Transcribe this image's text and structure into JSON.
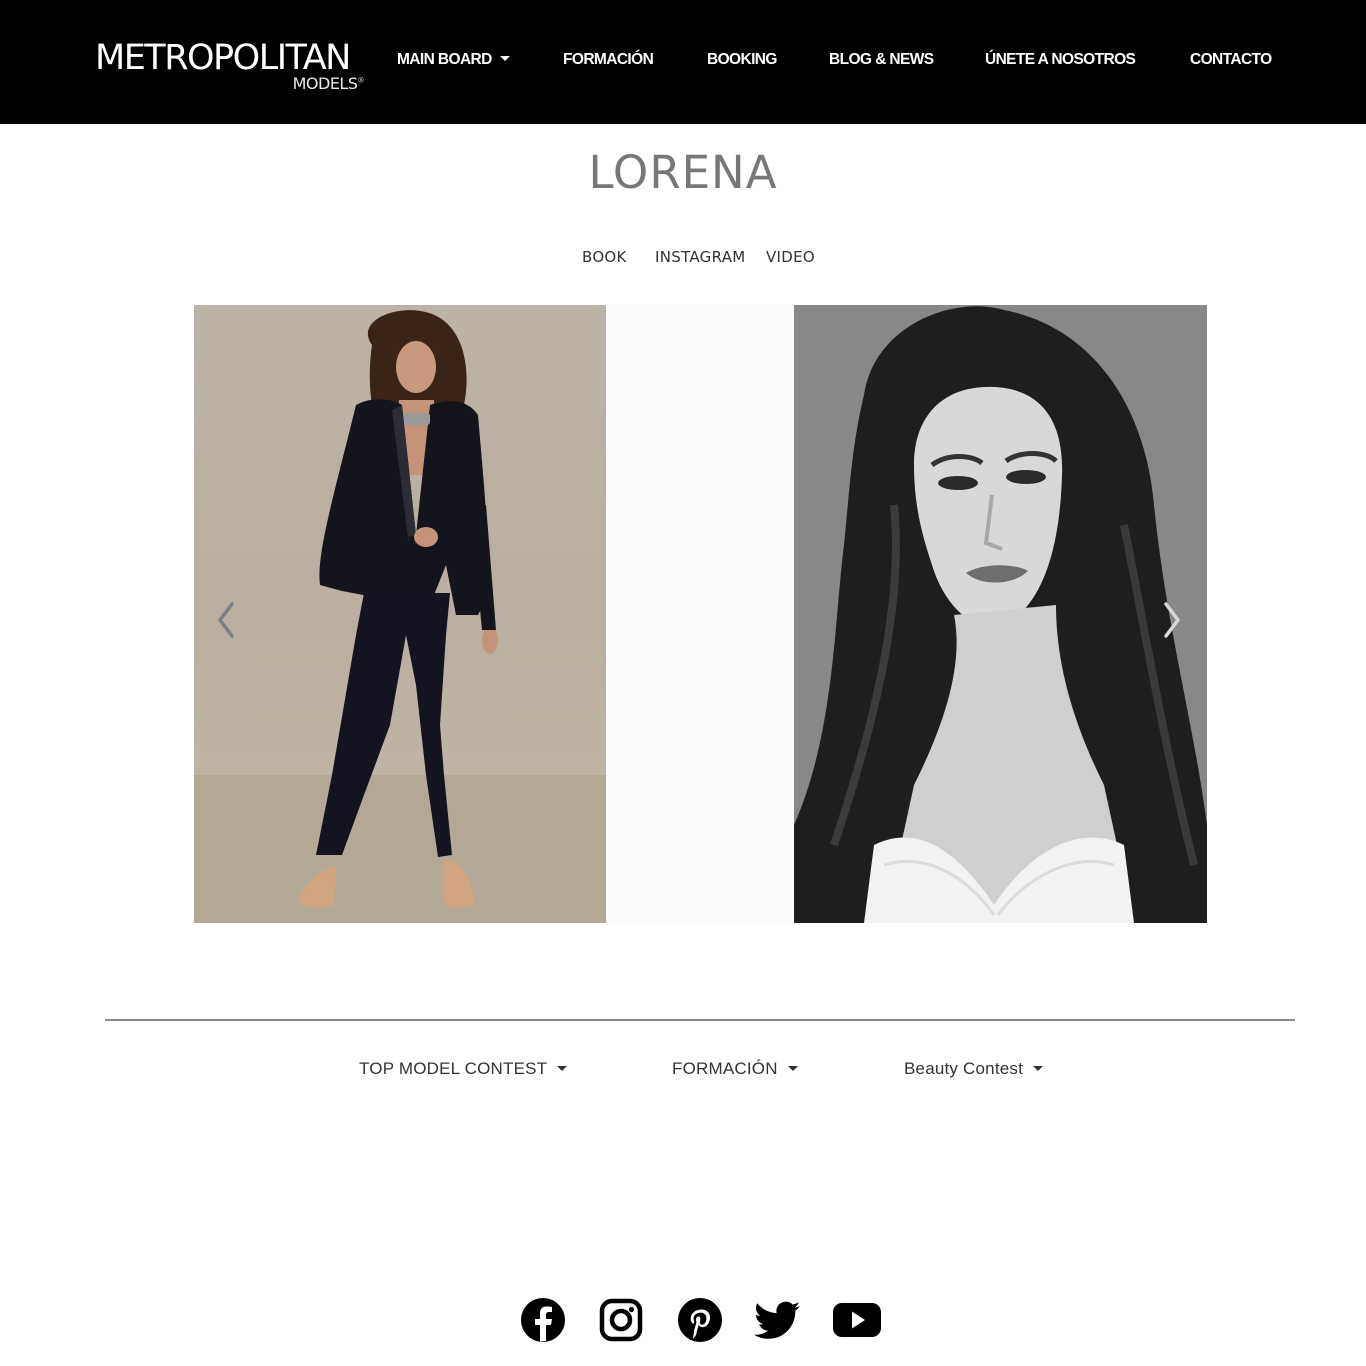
{
  "header": {
    "logo": {
      "main": "METROPOLITAN",
      "sub": "MODELS"
    },
    "nav": [
      {
        "label": "MAIN BOARD",
        "has_dropdown": true
      },
      {
        "label": "FORMACIÓN",
        "has_dropdown": false
      },
      {
        "label": "BOOKING",
        "has_dropdown": false
      },
      {
        "label": "BLOG & NEWS",
        "has_dropdown": false
      },
      {
        "label": "ÚNETE A NOSOTROS",
        "has_dropdown": false
      },
      {
        "label": "CONTACTO",
        "has_dropdown": false
      }
    ]
  },
  "profile": {
    "name": "LORENA",
    "tabs": [
      "BOOK",
      "INSTAGRAM",
      "VIDEO"
    ]
  },
  "carousel": {
    "slides": [
      {
        "description": "full-length-suit-photo"
      },
      {
        "description": "black-and-white-portrait"
      }
    ],
    "prev_icon": "chevron-left-icon",
    "next_icon": "chevron-right-icon"
  },
  "footer_menu": [
    {
      "label": "TOP MODEL CONTEST",
      "has_dropdown": true
    },
    {
      "label": "FORMACIÓN",
      "has_dropdown": true
    },
    {
      "label": "Beauty Contest",
      "has_dropdown": true
    }
  ],
  "social": [
    "facebook-icon",
    "instagram-icon",
    "pinterest-icon",
    "twitter-icon",
    "youtube-icon"
  ],
  "colors": {
    "header_bg": "#000000",
    "title": "#777777",
    "text": "#333333",
    "divider": "#8a8a8a"
  }
}
